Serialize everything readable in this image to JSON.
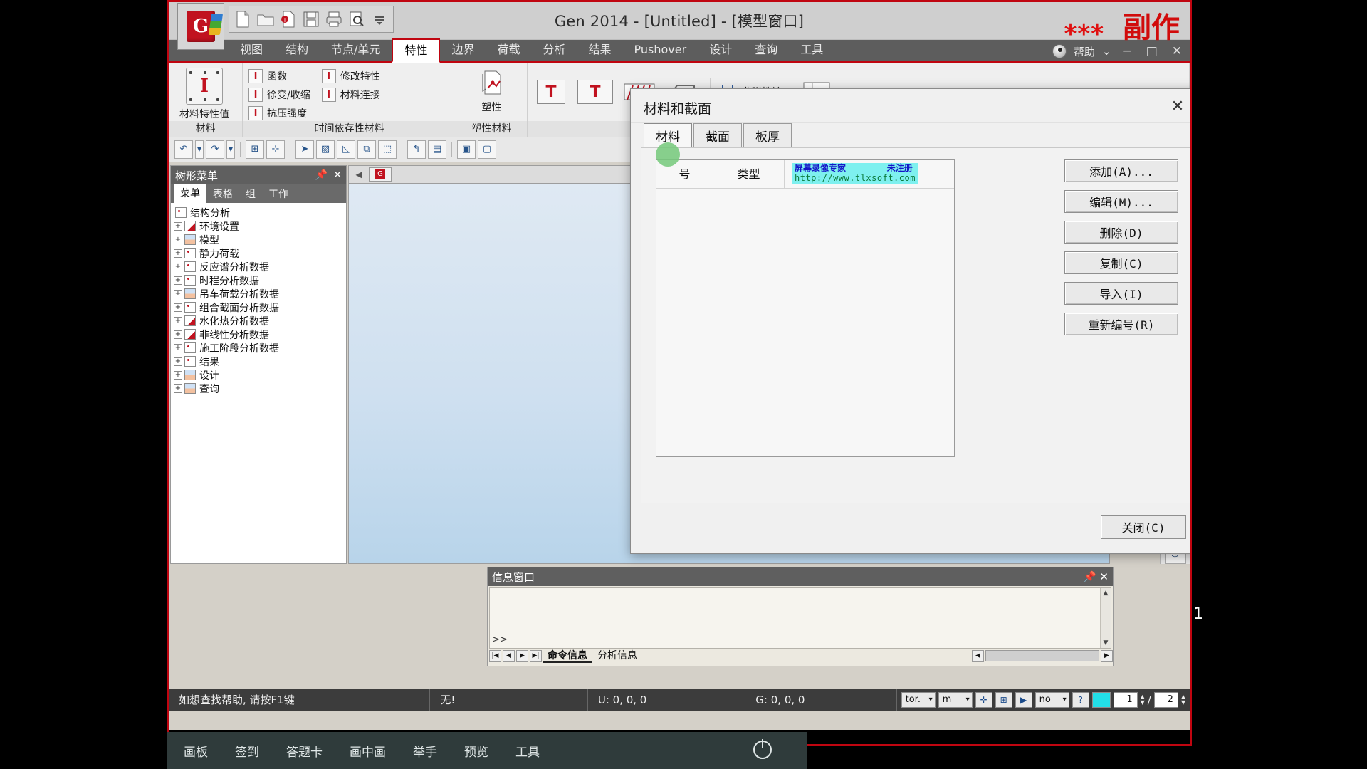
{
  "window": {
    "title": "Gen 2014 - [Untitled] - [模型窗口]",
    "app_logo": "g-logo-icon",
    "minimize": "−",
    "maximize": "□",
    "close": "✕",
    "help_label": "帮助",
    "help_caret": "⌄"
  },
  "overlay_watermark": {
    "stars": "***",
    "copy": "副作"
  },
  "quick_access": {
    "items": [
      {
        "name": "new-file-icon",
        "glyph": "🗋"
      },
      {
        "name": "open-file-icon",
        "glyph": "🗁"
      },
      {
        "name": "open-recent-icon",
        "glyph": "🗎"
      },
      {
        "name": "save-icon",
        "glyph": "🖫"
      },
      {
        "name": "print-icon",
        "glyph": "🖨"
      },
      {
        "name": "print-preview-icon",
        "glyph": "🔍"
      },
      {
        "name": "customize-qat-icon",
        "glyph": "▾"
      }
    ]
  },
  "ribbon": {
    "tabs": [
      {
        "label": "视图",
        "active": false
      },
      {
        "label": "结构",
        "active": false
      },
      {
        "label": "节点/单元",
        "active": false
      },
      {
        "label": "特性",
        "active": true
      },
      {
        "label": "边界",
        "active": false
      },
      {
        "label": "荷载",
        "active": false
      },
      {
        "label": "分析",
        "active": false
      },
      {
        "label": "结果",
        "active": false
      },
      {
        "label": "Pushover",
        "active": false
      },
      {
        "label": "设计",
        "active": false
      },
      {
        "label": "查询",
        "active": false
      },
      {
        "label": "工具",
        "active": false
      }
    ],
    "big_button": {
      "label": "材料特性值",
      "icon": "i-beam-icon"
    },
    "small_buttons_col1": [
      {
        "label": "函数",
        "icon": "function-icon"
      },
      {
        "label": "徐变/收缩",
        "icon": "creep-shrinkage-icon"
      },
      {
        "label": "抗压强度",
        "icon": "compressive-strength-icon"
      }
    ],
    "small_buttons_col2": [
      {
        "label": "修改特性",
        "icon": "modify-property-icon"
      },
      {
        "label": "材料连接",
        "icon": "material-link-icon"
      }
    ],
    "plastic_label": "塑性",
    "inelastic_hinge": {
      "label": "非弹性铰",
      "caret": "▾"
    },
    "group_footers": [
      {
        "label": "材料"
      },
      {
        "label": "时间依存性材料"
      },
      {
        "label": "塑性材料"
      }
    ]
  },
  "tree_panel": {
    "title": "树形菜单",
    "pin_icon": "pin-icon",
    "close_icon": "close-icon",
    "tabs": [
      {
        "label": "菜单",
        "active": true
      },
      {
        "label": "表格",
        "active": false
      },
      {
        "label": "组",
        "active": false
      },
      {
        "label": "工作",
        "active": false
      }
    ],
    "root": "结构分析",
    "items": [
      "环境设置",
      "模型",
      "静力荷载",
      "反应谱分析数据",
      "时程分析数据",
      "吊车荷载分析数据",
      "组合截面分析数据",
      "水化热分析数据",
      "非线性分析数据",
      "施工阶段分析数据",
      "结果",
      "设计",
      "查询"
    ],
    "expander": "+"
  },
  "dialog": {
    "title": "材料和截面",
    "close_glyph": "✕",
    "tabs": [
      {
        "label": "材料",
        "active": true
      },
      {
        "label": "截面",
        "active": false
      },
      {
        "label": "板厚",
        "active": false
      }
    ],
    "list_headers": [
      "号",
      "类型"
    ],
    "list_rows": [],
    "recorder_watermark": {
      "line1": "屏幕录像专家        未注册",
      "line2": "http://www.tlxsoft.com"
    },
    "buttons": [
      {
        "label": "添加(A)...",
        "name": "add-button"
      },
      {
        "label": "编辑(M)...",
        "name": "edit-button"
      },
      {
        "label": "删除(D)",
        "name": "delete-button"
      },
      {
        "label": "复制(C)",
        "name": "copy-button"
      },
      {
        "label": "导入(I)",
        "name": "import-button"
      },
      {
        "label": "重新编号(R)",
        "name": "renumber-button"
      }
    ],
    "close_button": "关闭(C)"
  },
  "message_panel": {
    "title": "信息窗口",
    "pin_icon": "pin-icon",
    "close_icon": "close-icon",
    "prompt": ">>",
    "tabs": [
      {
        "label": "命令信息",
        "active": true
      },
      {
        "label": "分析信息",
        "active": false
      }
    ],
    "scroll_up": "▲",
    "scroll_down": "▼",
    "nav_first": "|◀",
    "nav_prev": "◀",
    "nav_next": "▶",
    "nav_last": "▶|",
    "h_scroll_left": "◀",
    "h_scroll_right": "▶"
  },
  "status_bar": {
    "help_hint": "如想查找帮助, 请按F1键",
    "selection": "无!",
    "unit_coord": "U: 0, 0, 0",
    "global_coord": "G: 0, 0, 0",
    "unit_force": "tor.",
    "unit_length": "m",
    "snap_icon": "snap-icon",
    "grid_icon": "grid-icon",
    "run_icon": "▶",
    "mode": "no",
    "help_q": "?",
    "page_current": "1",
    "page_sep": "/",
    "page_total": "2"
  },
  "taskbar": {
    "items": [
      "画板",
      "签到",
      "答题卡",
      "画中画",
      "举手",
      "预览",
      "工具"
    ],
    "power_icon": "power-icon"
  },
  "colors": {
    "accent_red": "#c00510",
    "ribbon_dark": "#5d5d5d",
    "dialog_bg": "#f0f0f0",
    "watermark_cyan": "#7ef0ef",
    "taskbar": "#2f3b3b"
  },
  "page_marker": "1"
}
